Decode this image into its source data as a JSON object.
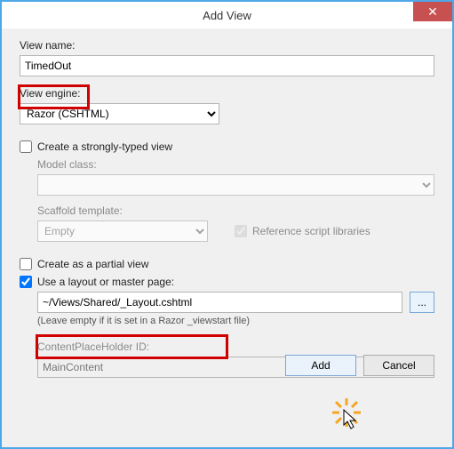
{
  "window": {
    "title": "Add View",
    "close_glyph": "✕"
  },
  "labels": {
    "view_name": "View name:",
    "view_engine": "View engine:",
    "strongly_typed": "Create a strongly-typed view",
    "model_class": "Model class:",
    "scaffold_template": "Scaffold template:",
    "ref_script": "Reference script libraries",
    "partial_view": "Create as a partial view",
    "use_layout": "Use a layout or master page:",
    "layout_hint": "(Leave empty if it is set in a Razor _viewstart file)",
    "cph_id": "ContentPlaceHolder ID:"
  },
  "values": {
    "view_name": "TimedOut",
    "view_engine": "Razor (CSHTML)",
    "model_class": "",
    "scaffold_template": "Empty",
    "layout_path": "~/Views/Shared/_Layout.cshtml",
    "cph_id": "MainContent"
  },
  "buttons": {
    "browse": "...",
    "add": "Add",
    "cancel": "Cancel"
  }
}
